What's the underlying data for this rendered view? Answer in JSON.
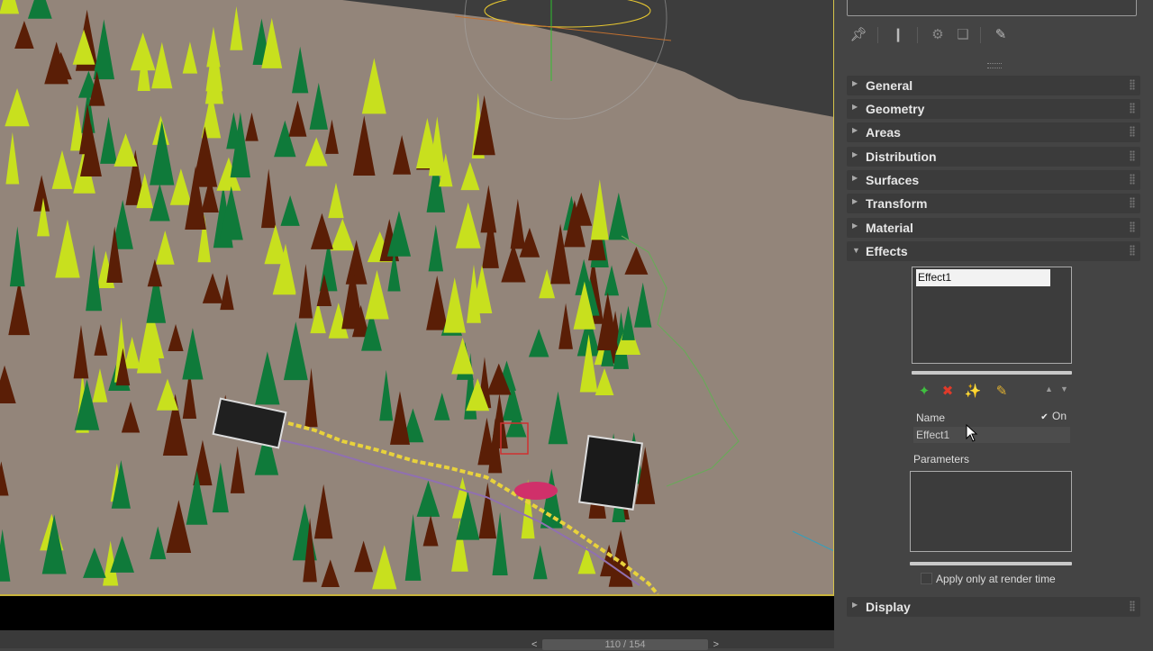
{
  "panel": {
    "rollouts": [
      {
        "label": "General",
        "expanded": false
      },
      {
        "label": "Geometry",
        "expanded": false
      },
      {
        "label": "Areas",
        "expanded": false
      },
      {
        "label": "Distribution",
        "expanded": false
      },
      {
        "label": "Surfaces",
        "expanded": false
      },
      {
        "label": "Transform",
        "expanded": false
      },
      {
        "label": "Material",
        "expanded": false
      },
      {
        "label": "Effects",
        "expanded": true
      },
      {
        "label": "Display",
        "expanded": false
      }
    ],
    "effects": {
      "list_items": [
        "Effect1"
      ],
      "name_label": "Name",
      "on_label": "On",
      "on_checked": true,
      "name_value": "Effect1",
      "parameters_label": "Parameters",
      "apply_render_label": "Apply only at render time",
      "apply_render_checked": false
    },
    "toolbar_icons": [
      "pin-icon",
      "modifier-stack-icon",
      "make-unique-icon",
      "remove-modifier-icon",
      "configure-modifier-sets-icon"
    ]
  },
  "timeline": {
    "frame_label": "110 / 154"
  },
  "colors": {
    "tree_dark_green": "#0f7a3a",
    "tree_yellow_green": "#c8e01e",
    "tree_brown": "#5a1e06",
    "ground": "#93857a",
    "path_yellow": "#e8d23c"
  }
}
